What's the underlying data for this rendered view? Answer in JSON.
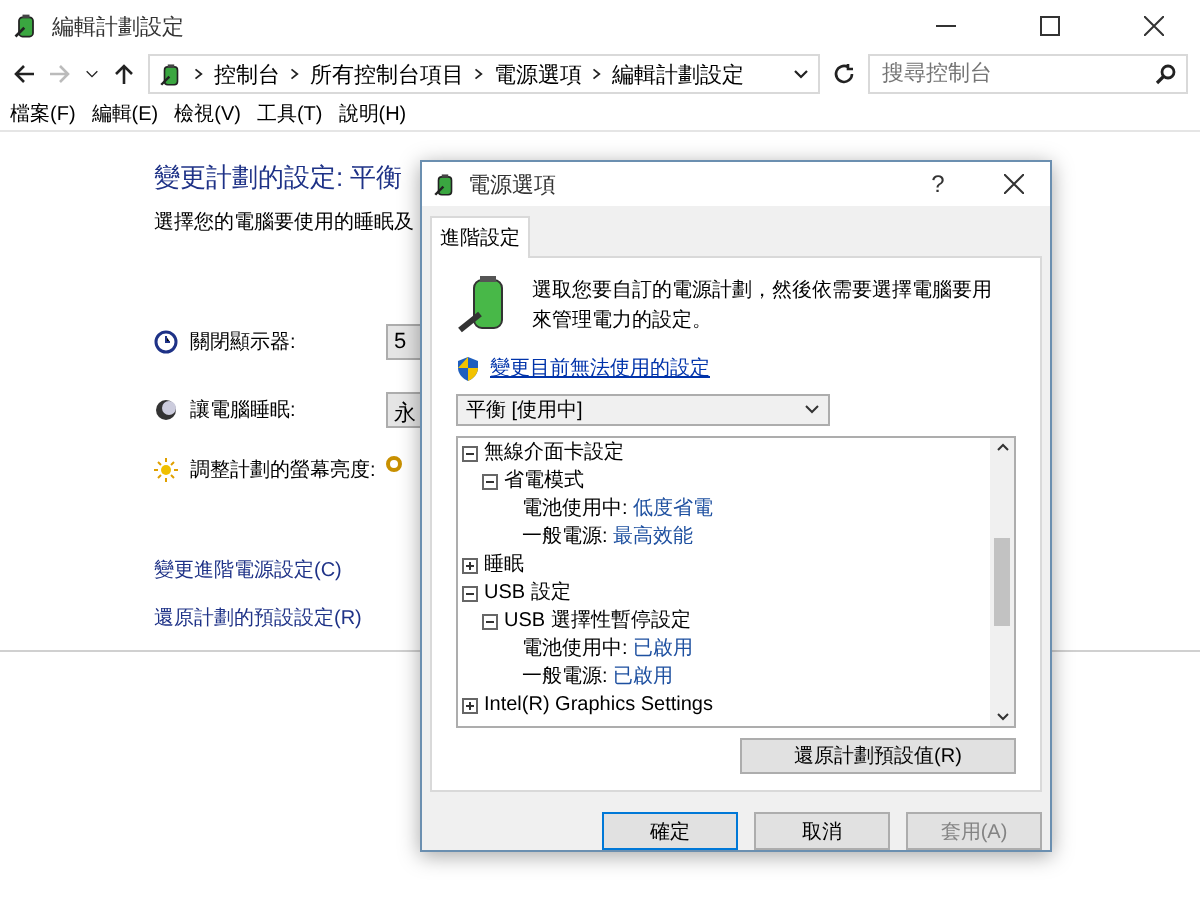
{
  "window": {
    "title": "編輯計劃設定"
  },
  "address_bar": {
    "path": [
      "控制台",
      "所有控制台項目",
      "電源選項",
      "編輯計劃設定"
    ]
  },
  "search": {
    "placeholder": "搜尋控制台"
  },
  "menu": [
    "檔案(F)",
    "編輯(E)",
    "檢視(V)",
    "工具(T)",
    "說明(H)"
  ],
  "page": {
    "title": "變更計劃的設定: 平衡",
    "subtitle": "選擇您的電腦要使用的睡眠及",
    "rows": [
      {
        "kind": "dropdown",
        "label": "關閉顯示器:",
        "value": "5"
      },
      {
        "kind": "dropdown",
        "label": "讓電腦睡眠:",
        "value": "永"
      },
      {
        "kind": "slider",
        "label": "調整計劃的螢幕亮度:",
        "level": 0
      }
    ],
    "links": [
      "變更進階電源設定(C)",
      "還原計劃的預設設定(R)"
    ]
  },
  "dialog": {
    "title": "電源選項",
    "help": "?",
    "tabs": [
      {
        "label": "進階設定",
        "selected": true
      }
    ],
    "description": "選取您要自訂的電源計劃，然後依需要選擇電腦要用來管理電力的設定。",
    "shield_link": "變更目前無法使用的設定",
    "plan_select": {
      "value": "平衡 [使用中]"
    },
    "tree": [
      {
        "label": "無線介面卡設定",
        "expanded": true,
        "children": [
          {
            "label": "省電模式",
            "expanded": true,
            "children": [
              {
                "label": "電池使用中:",
                "value": "低度省電"
              },
              {
                "label": "一般電源:",
                "value": "最高效能"
              }
            ]
          }
        ]
      },
      {
        "label": "睡眠",
        "expanded": false
      },
      {
        "label": "USB 設定",
        "expanded": true,
        "children": [
          {
            "label": "USB 選擇性暫停設定",
            "expanded": true,
            "children": [
              {
                "label": "電池使用中:",
                "value": "已啟用"
              },
              {
                "label": "一般電源:",
                "value": "已啟用"
              }
            ]
          }
        ]
      },
      {
        "label": "Intel(R) Graphics Settings",
        "expanded": false
      }
    ],
    "restore_button": "還原計劃預設值(R)",
    "buttons": [
      {
        "label": "確定",
        "disabled": false,
        "default": true
      },
      {
        "label": "取消",
        "disabled": false,
        "default": false
      },
      {
        "label": "套用(A)",
        "disabled": true,
        "default": false
      }
    ]
  }
}
